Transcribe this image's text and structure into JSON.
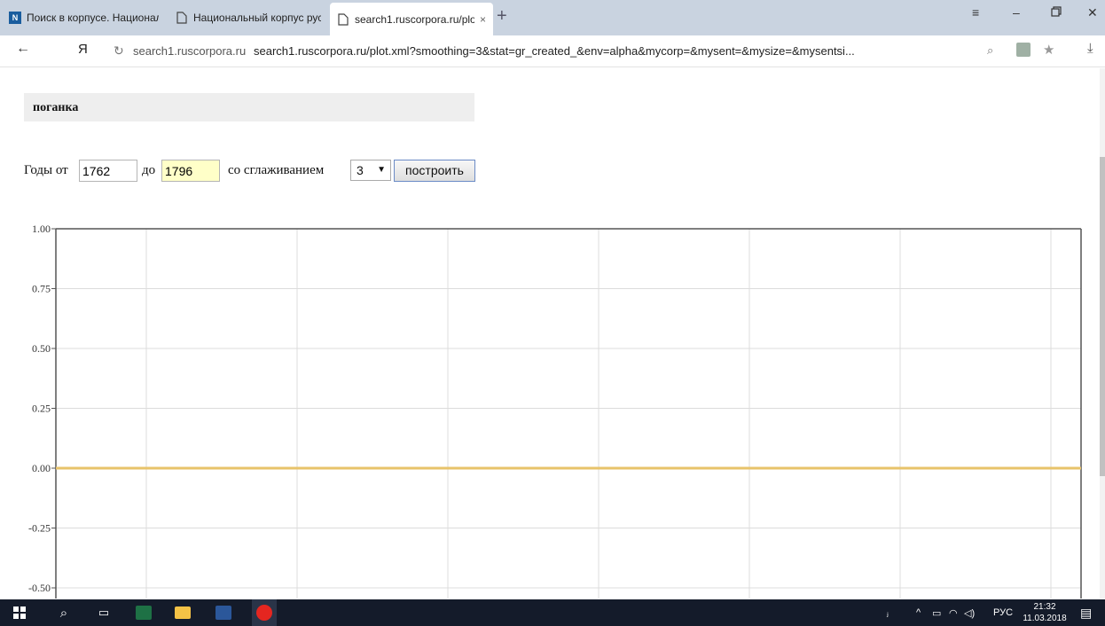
{
  "tabs": [
    {
      "title": "Поиск в корпусе. Национал",
      "icon": "ncrl-icon"
    },
    {
      "title": "Национальный корпус русс",
      "icon": "page-icon"
    },
    {
      "title": "search1.ruscorpora.ru/plo",
      "icon": "page-icon",
      "active": true
    }
  ],
  "tab_close": "×",
  "new_tab": "+",
  "address": {
    "host": "search1.ruscorpora.ru",
    "url": "search1.ruscorpora.ru/plot.xml?smoothing=3&stat=gr_created_&env=alpha&mycorp=&mysent=&mysize=&mysentsi..."
  },
  "query": "поганка",
  "form": {
    "from_label": "Годы от",
    "from_value": "1762",
    "to_label": "до",
    "to_value": "1796",
    "smoothing_label": "со сглаживанием",
    "smoothing_value": "3",
    "submit_label": "построить"
  },
  "chart_data": {
    "type": "line",
    "ylim": [
      -0.5,
      1.0
    ],
    "yticks": [
      "1.00",
      "0.75",
      "0.50",
      "0.25",
      "0.00",
      "-0.25",
      "-0.50"
    ],
    "grid": true,
    "series": [
      {
        "color": "#e8c36a",
        "x": [
          1762,
          1796
        ],
        "values": [
          0,
          0
        ]
      }
    ]
  },
  "taskbar": {
    "lang": "РУС",
    "time": "21:32",
    "date": "11.03.2018"
  }
}
